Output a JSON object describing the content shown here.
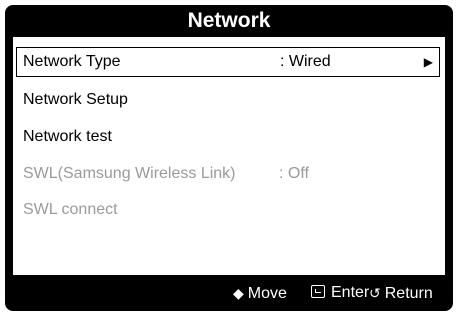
{
  "window": {
    "title": "Network"
  },
  "menu": {
    "items": [
      {
        "label": "Network Type",
        "value": ": Wired",
        "arrow": "▶"
      },
      {
        "label": "Network Setup"
      },
      {
        "label": "Network test"
      },
      {
        "label": "SWL(Samsung Wireless Link)",
        "value": ": Off"
      },
      {
        "label": "SWL connect"
      }
    ]
  },
  "footer": {
    "move_icon": "◆",
    "move_label": "Move",
    "enter_label": "Enter",
    "return_icon": "↺",
    "return_label": "Return"
  },
  "colors": {
    "background": "#000000",
    "panel": "#ffffff",
    "text": "#000000",
    "disabled_text": "#9a9a9a",
    "footer_text": "#ffffff"
  },
  "icons": [
    "up-down-icon",
    "enter-icon",
    "return-icon",
    "right-arrow-icon"
  ]
}
